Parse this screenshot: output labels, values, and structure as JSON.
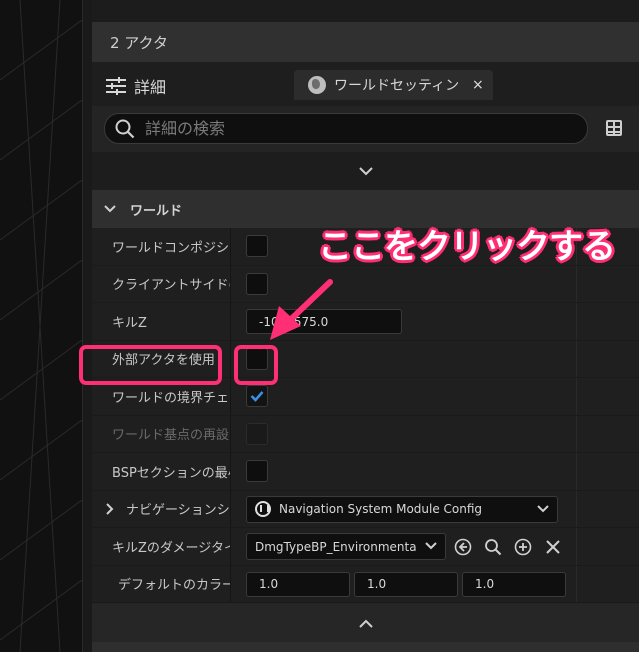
{
  "actor_bar": {
    "title": "2 アクタ"
  },
  "tabs": {
    "details_label": "詳細",
    "world_tab_label": "ワールドセッティン",
    "world_tab_close": "×"
  },
  "search": {
    "placeholder": "詳細の検索",
    "value": ""
  },
  "section": {
    "title": "ワールド"
  },
  "rows": [
    {
      "label": "ワールドコンポジシ",
      "type": "checkbox",
      "checked": false
    },
    {
      "label": "クライアントサイドの",
      "type": "checkbox",
      "checked": false
    },
    {
      "label": "キルZ",
      "type": "number",
      "value": "-1048575.0"
    },
    {
      "label": "外部アクタを使用",
      "type": "checkbox",
      "checked": false
    },
    {
      "label": "ワールドの境界チェッ",
      "type": "checkbox",
      "checked": true
    },
    {
      "label": "ワールド基点の再設",
      "type": "checkbox",
      "checked": false,
      "disabled": true
    },
    {
      "label": "BSPセクションの最小",
      "type": "checkbox",
      "checked": false
    },
    {
      "label": "ナビゲーションシ",
      "type": "dropdown",
      "value": "Navigation System Module Config"
    },
    {
      "label": "キルZのダメージタイ",
      "type": "dropdown",
      "value": "DmgTypeBP_Environmenta"
    },
    {
      "label": "デフォルトのカラー",
      "type": "vector",
      "values": [
        "1.0",
        "1.0",
        "1.0"
      ]
    }
  ],
  "annotation": {
    "text": "ここをクリックする"
  },
  "colors": {
    "accent": "#ff2f75",
    "check": "#3a8ee6",
    "panel": "#242424"
  },
  "icons": [
    "sliders-icon",
    "globe-icon",
    "close-icon",
    "search-icon",
    "table-icon",
    "chevron-down-icon",
    "chevron-right-icon",
    "chevron-up-icon",
    "unreal-icon",
    "browse-back-icon",
    "search-asset-icon",
    "add-icon",
    "clear-icon",
    "arrow-icon"
  ]
}
